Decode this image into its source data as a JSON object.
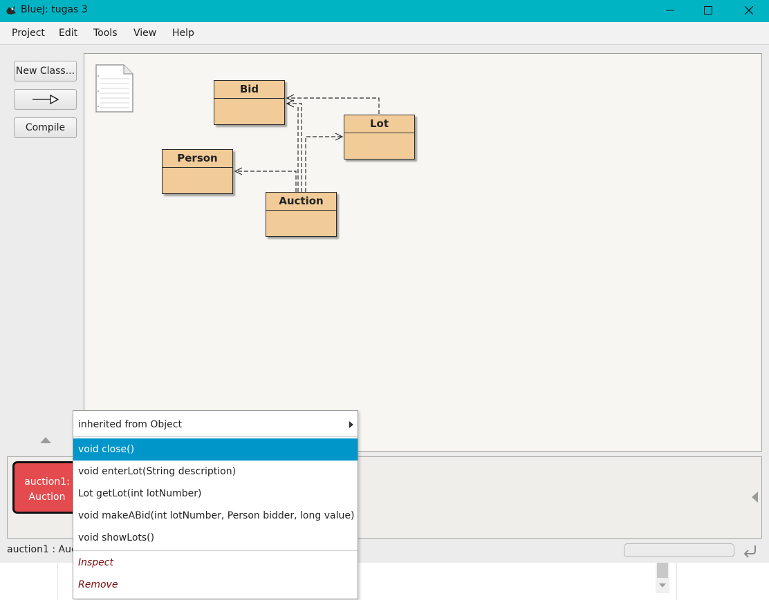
{
  "window": {
    "app_name": "BlueJ:",
    "project_name": "tugas 3"
  },
  "menubar": {
    "items": [
      "Project",
      "Edit",
      "Tools",
      "View",
      "Help"
    ]
  },
  "toolbar": {
    "new_class_label": "New Class...",
    "compile_label": "Compile"
  },
  "diagram": {
    "classes": [
      "Bid",
      "Lot",
      "Person",
      "Auction"
    ]
  },
  "object_bench": {
    "object_name": "auction1:",
    "object_type": "Auction"
  },
  "status": {
    "text": "auction1 : Auc"
  },
  "popup_menu": {
    "inherited_label": "inherited from Object",
    "methods": [
      "void close()",
      "void enterLot(String description)",
      "Lot getLot(int lotNumber)",
      "void makeABid(int lotNumber, Person bidder, long value)",
      "void showLots()"
    ],
    "selected_index": 0,
    "actions": [
      "Inspect",
      "Remove"
    ]
  },
  "colors": {
    "titlebar": "#00b4c4",
    "class_fill": "#f1cc99",
    "object_fill": "#e34b4f",
    "menu_highlight": "#0096c9",
    "action_text": "#7a0c0c"
  }
}
